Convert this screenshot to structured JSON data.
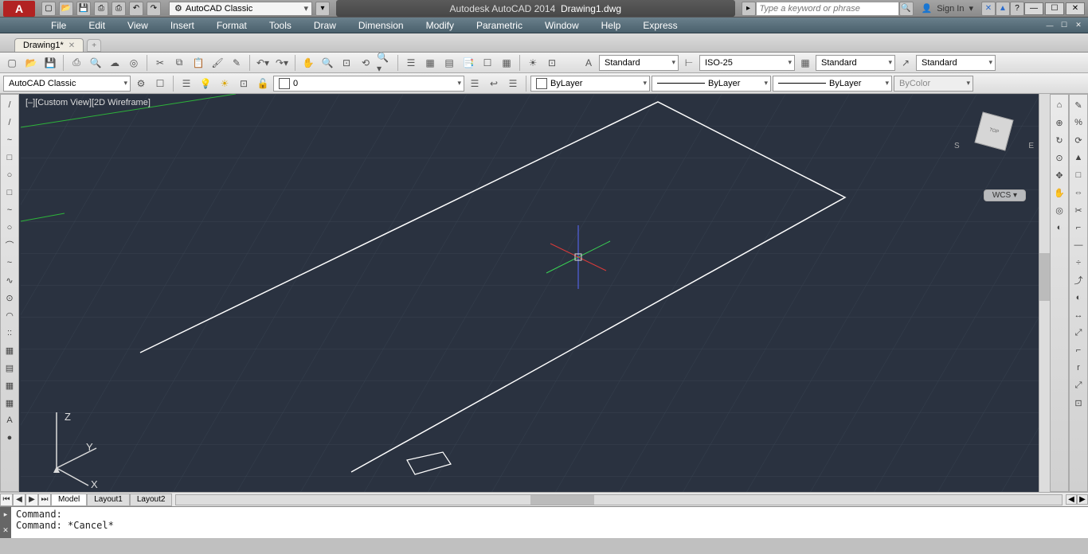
{
  "title": {
    "product": "Autodesk AutoCAD 2014",
    "file": "Drawing1.dwg"
  },
  "workspace_selector": "AutoCAD Classic",
  "search_placeholder": "Type a keyword or phrase",
  "signin_label": "Sign In",
  "menu": [
    "File",
    "Edit",
    "View",
    "Insert",
    "Format",
    "Tools",
    "Draw",
    "Dimension",
    "Modify",
    "Parametric",
    "Window",
    "Help",
    "Express"
  ],
  "doc_tab": "Drawing1*",
  "ribbon2": {
    "workspace": "AutoCAD Classic",
    "layer": "0",
    "linetype_layer": "ByLayer",
    "lineweight": "ByLayer",
    "plotstyle": "ByLayer",
    "color_label": "ByColor",
    "text_style": "Standard",
    "dim_style": "ISO-25",
    "table_style": "Standard",
    "mleader_style": "Standard"
  },
  "viewport_label": "[–][Custom View][2D Wireframe]",
  "wcs": "WCS",
  "compass": {
    "s": "S",
    "e": "E"
  },
  "ucs_axes": {
    "x": "X",
    "y": "Y",
    "z": "Z"
  },
  "layout_tabs": [
    "Model",
    "Layout1",
    "Layout2"
  ],
  "command_text": "Command:\nCommand: *Cancel*",
  "draw_tools": [
    "/",
    "/",
    "~",
    "□",
    "○",
    "□",
    "~",
    "○",
    "⌒",
    "~",
    "∿",
    "⊙",
    "◠",
    "::",
    "▦",
    "▤",
    "▦",
    "▦",
    "A",
    "●"
  ],
  "modify_tools": [
    "✎",
    "%",
    "⟳",
    "▲",
    "□",
    "⇔",
    "✂",
    "⌐",
    "—",
    "÷",
    "⤴",
    "◐",
    "↔",
    "⤢",
    "⌐",
    "r",
    "⤢",
    "⊡"
  ],
  "right_nav_tools": [
    "⌂",
    "⊕",
    "↻",
    "⊙",
    "✥",
    "✋",
    "◎",
    "◐"
  ]
}
